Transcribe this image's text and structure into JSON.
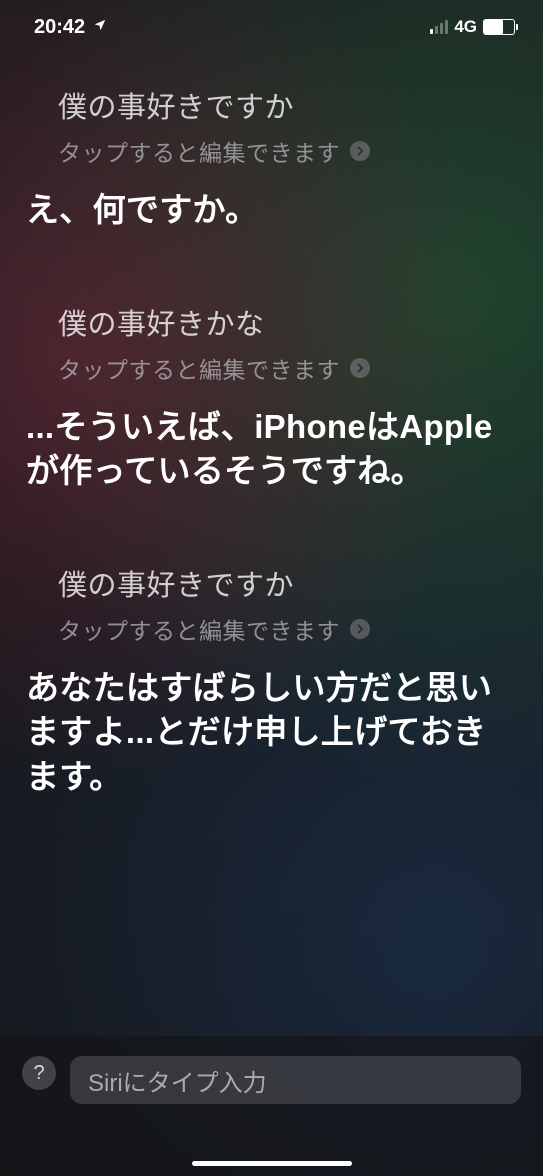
{
  "status": {
    "time": "20:42",
    "network": "4G"
  },
  "hint": "タップすると編集できます",
  "conversation": [
    {
      "user": "僕の事好きですか",
      "siri": "え、何ですか。"
    },
    {
      "user": "僕の事好きかな",
      "siri": "...そういえば、iPhoneはAppleが作っているそうですね。"
    },
    {
      "user": "僕の事好きですか",
      "siri": "あなたはすばらしい方だと思いますよ...とだけ申し上げておきます。"
    }
  ],
  "input": {
    "placeholder": "Siriにタイプ入力"
  },
  "help": "?"
}
